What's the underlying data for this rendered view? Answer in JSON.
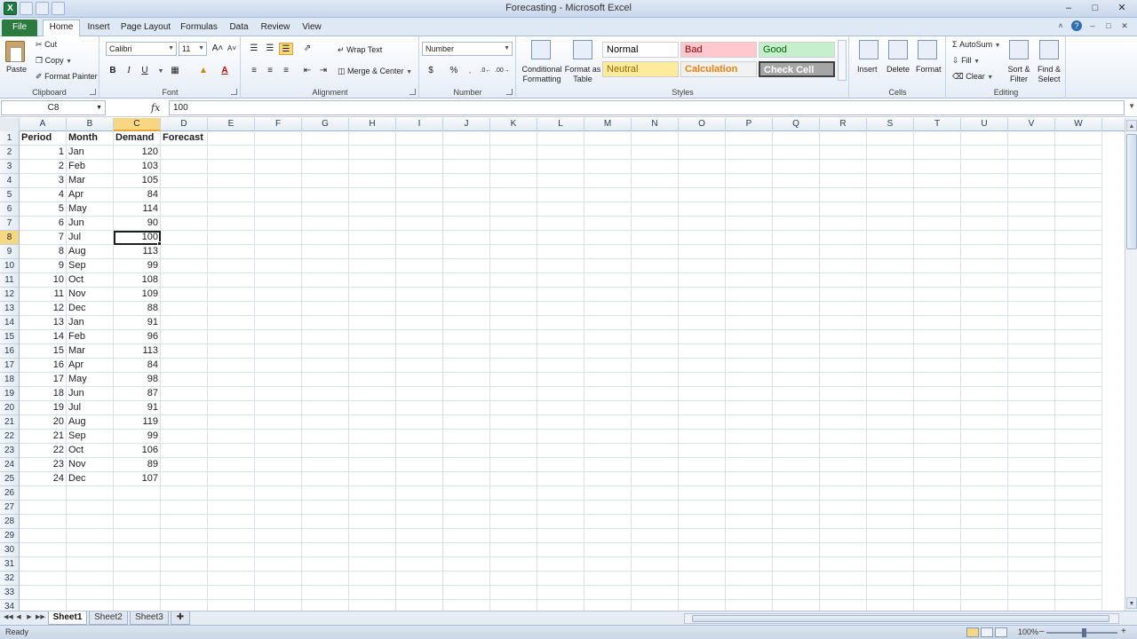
{
  "window": {
    "title": "Forecasting - Microsoft Excel",
    "app_icon": "X"
  },
  "ribbon_tabs": [
    "File",
    "Home",
    "Insert",
    "Page Layout",
    "Formulas",
    "Data",
    "Review",
    "View"
  ],
  "clipboard": {
    "paste": "Paste",
    "cut": "Cut",
    "copy": "Copy",
    "format_painter": "Format Painter",
    "label": "Clipboard"
  },
  "font": {
    "name": "Calibri",
    "size": "11",
    "label": "Font"
  },
  "alignment": {
    "wrap_text": "Wrap Text",
    "merge_center": "Merge & Center",
    "label": "Alignment"
  },
  "number": {
    "format": "Number",
    "label": "Number"
  },
  "styles": {
    "conditional_formatting": "Conditional Formatting",
    "format_as_table": "Format as Table",
    "cells": [
      {
        "name": "Normal",
        "bg": "#ffffff",
        "fg": "#000000"
      },
      {
        "name": "Bad",
        "bg": "#ffc7ce",
        "fg": "#9c0006"
      },
      {
        "name": "Good",
        "bg": "#c6efce",
        "fg": "#006100"
      },
      {
        "name": "Neutral",
        "bg": "#ffeb9c",
        "fg": "#9c6500"
      },
      {
        "name": "Calculation",
        "bg": "#f2f2f2",
        "fg": "#fa7d00"
      },
      {
        "name": "Check Cell",
        "bg": "#a5a5a5",
        "fg": "#ffffff"
      }
    ],
    "label": "Styles"
  },
  "cells_group": {
    "insert": "Insert",
    "delete": "Delete",
    "format": "Format",
    "label": "Cells"
  },
  "editing": {
    "autosum": "AutoSum",
    "fill": "Fill",
    "clear": "Clear",
    "sort_filter": "Sort & Filter",
    "find_select": "Find & Select",
    "label": "Editing"
  },
  "formula_bar": {
    "name_box": "C8",
    "fx": "fx",
    "content": "100"
  },
  "columns": [
    "A",
    "B",
    "C",
    "D",
    "E",
    "F",
    "G",
    "H",
    "I",
    "J",
    "K",
    "L",
    "M",
    "N",
    "O",
    "P",
    "Q",
    "R",
    "S",
    "T",
    "U",
    "V",
    "W"
  ],
  "headers": [
    "Period",
    "Month",
    "Demand",
    "Forecast"
  ],
  "data_rows": [
    {
      "period": "1",
      "month": "Jan",
      "demand": "120"
    },
    {
      "period": "2",
      "month": "Feb",
      "demand": "103"
    },
    {
      "period": "3",
      "month": "Mar",
      "demand": "105"
    },
    {
      "period": "4",
      "month": "Apr",
      "demand": "84"
    },
    {
      "period": "5",
      "month": "May",
      "demand": "114"
    },
    {
      "period": "6",
      "month": "Jun",
      "demand": "90"
    },
    {
      "period": "7",
      "month": "Jul",
      "demand": "100"
    },
    {
      "period": "8",
      "month": "Aug",
      "demand": "113"
    },
    {
      "period": "9",
      "month": "Sep",
      "demand": "99"
    },
    {
      "period": "10",
      "month": "Oct",
      "demand": "108"
    },
    {
      "period": "11",
      "month": "Nov",
      "demand": "109"
    },
    {
      "period": "12",
      "month": "Dec",
      "demand": "88"
    },
    {
      "period": "13",
      "month": "Jan",
      "demand": "91"
    },
    {
      "period": "14",
      "month": "Feb",
      "demand": "96"
    },
    {
      "period": "15",
      "month": "Mar",
      "demand": "113"
    },
    {
      "period": "16",
      "month": "Apr",
      "demand": "84"
    },
    {
      "period": "17",
      "month": "May",
      "demand": "98"
    },
    {
      "period": "18",
      "month": "Jun",
      "demand": "87"
    },
    {
      "period": "19",
      "month": "Jul",
      "demand": "91"
    },
    {
      "period": "20",
      "month": "Aug",
      "demand": "119"
    },
    {
      "period": "21",
      "month": "Sep",
      "demand": "99"
    },
    {
      "period": "22",
      "month": "Oct",
      "demand": "106"
    },
    {
      "period": "23",
      "month": "Nov",
      "demand": "89"
    },
    {
      "period": "24",
      "month": "Dec",
      "demand": "107"
    }
  ],
  "visible_rows": 34,
  "selected_cell": {
    "col": "C",
    "row": 8
  },
  "sheets": [
    "Sheet1",
    "Sheet2",
    "Sheet3"
  ],
  "active_sheet": "Sheet1",
  "status": {
    "ready": "Ready",
    "zoom": "100%"
  },
  "colors": {
    "accent_selection": "#f8d783",
    "file_tab": "#2b7a3f"
  }
}
